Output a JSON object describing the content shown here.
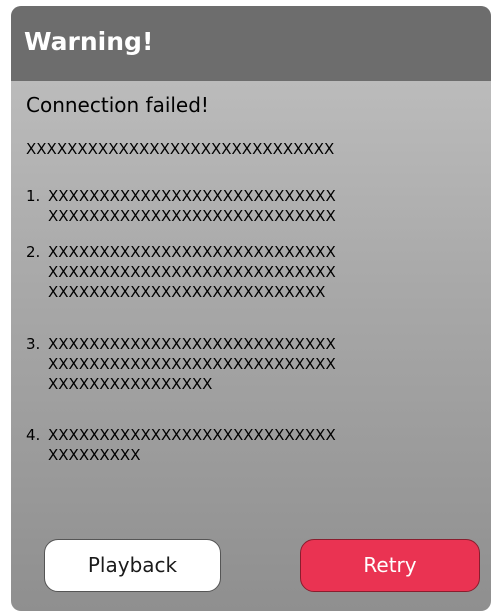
{
  "dialog": {
    "title": "Warning!",
    "subtitle": "Connection failed!",
    "intro": "XXXXXXXXXXXXXXXXXXXXXXXXXXXXXX",
    "steps": [
      {
        "number": "1.",
        "lines": [
          "XXXXXXXXXXXXXXXXXXXXXXXXXXXX",
          "XXXXXXXXXXXXXXXXXXXXXXXXXXXX"
        ]
      },
      {
        "number": "2.",
        "lines": [
          "XXXXXXXXXXXXXXXXXXXXXXXXXXXX",
          "XXXXXXXXXXXXXXXXXXXXXXXXXXXX",
          "XXXXXXXXXXXXXXXXXXXXXXXXXXX"
        ]
      },
      {
        "number": "3.",
        "lines": [
          "XXXXXXXXXXXXXXXXXXXXXXXXXXXX",
          "XXXXXXXXXXXXXXXXXXXXXXXXXXXX",
          "XXXXXXXXXXXXXXXX"
        ]
      },
      {
        "number": "4.",
        "lines": [
          "XXXXXXXXXXXXXXXXXXXXXXXXXXXX",
          "XXXXXXXXX"
        ]
      }
    ],
    "buttons": {
      "playback": "Playback",
      "retry": "Retry"
    },
    "colors": {
      "header": "#6d6d6d",
      "retry": "#ea3352"
    }
  }
}
